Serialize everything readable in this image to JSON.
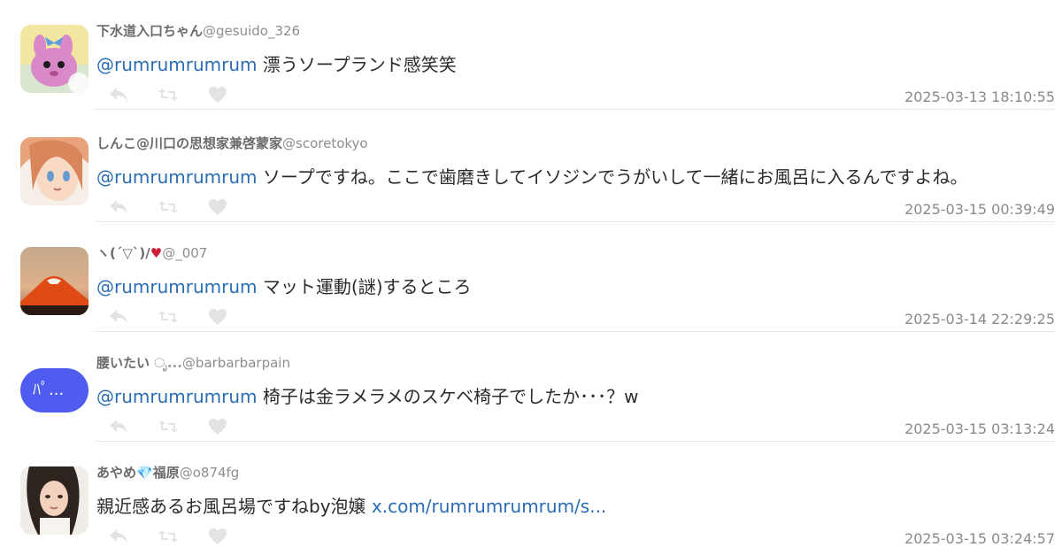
{
  "replies": [
    {
      "name": "下水道入口ちゃん",
      "name_suffix": "",
      "handle": "@gesuido_326",
      "mention": "@rumrumrumrum",
      "text": " 漂うソープランド感笑笑",
      "link": "",
      "time": "2025-03-13 18:10:55"
    },
    {
      "name": "しんこ@川口の思想家兼啓蒙家",
      "name_suffix": "",
      "handle": "@scoretokyo",
      "mention": "@rumrumrumrum",
      "text": " ソープですね。ここで歯磨きしてイソジンでうがいして一緒にお風呂に入るんですよね。",
      "link": "",
      "time": "2025-03-15 00:39:49"
    },
    {
      "name": "ヽ(´▽`)/",
      "name_suffix": "♥",
      "handle": "@_007",
      "mention": "@rumrumrumrum",
      "text": " マット運動(謎)するところ",
      "link": "",
      "time": "2025-03-14 22:29:25"
    },
    {
      "name": "腰いたい",
      "name_suffix": " ೃ...",
      "handle": "@barbarbarpain",
      "mention": "@rumrumrumrum",
      "text": " 椅子は金ラメラメのスケベ椅子でしたか･･･？w",
      "link": "",
      "time": "2025-03-15 03:13:24"
    },
    {
      "name": "あやめ",
      "name_mid": "💎",
      "name_suffix": "福原",
      "handle": "@o874fg",
      "mention": "",
      "text": "親近感あるお風呂場ですねby泡嬢 ",
      "link": "x.com/rumrumrumrum/s...",
      "time": "2025-03-15 03:24:57"
    }
  ],
  "avatar4_label": "ﾊﾟ...",
  "icons": [
    "reply-icon",
    "retweet-icon",
    "like-icon"
  ],
  "colors": {
    "mention": "#2a6db5",
    "timestamp": "#8a8a8a",
    "action_icon": "#e3e3e3",
    "heart": "#cc1f3a"
  }
}
